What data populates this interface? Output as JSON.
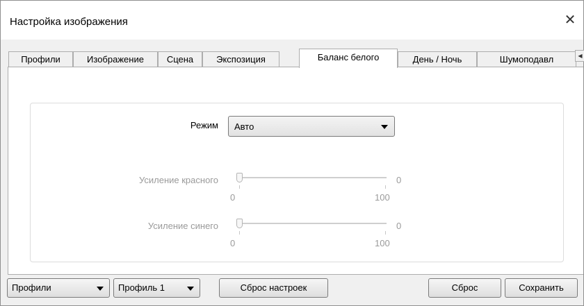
{
  "window": {
    "title": "Настройка изображения",
    "close_glyph": "✕"
  },
  "tabs": [
    {
      "label": "Профили"
    },
    {
      "label": "Изображение"
    },
    {
      "label": "Сцена"
    },
    {
      "label": "Экспозиция"
    },
    {
      "label": "Баланс белого",
      "active": true
    },
    {
      "label": "День / Ночь"
    },
    {
      "label": "Шумоподавл"
    }
  ],
  "tab_scroll": {
    "left_glyph": "◀",
    "right_glyph": "▶"
  },
  "form": {
    "mode_label": "Режим",
    "mode_value": "Авто",
    "red_gain": {
      "label": "Усиление красного",
      "min": "0",
      "max": "100",
      "value": "0",
      "level": 0
    },
    "blue_gain": {
      "label": "Усиление синего",
      "min": "0",
      "max": "100",
      "value": "0",
      "level": 0
    }
  },
  "footer": {
    "profiles_dropdown": "Профили",
    "profile_select": "Профиль 1",
    "reset_settings": "Сброс настроек",
    "reset": "Сброс",
    "save": "Сохранить"
  }
}
